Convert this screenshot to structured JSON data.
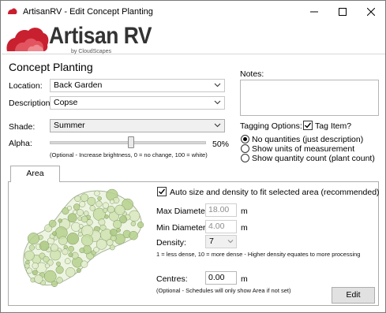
{
  "window": {
    "title": "ArtisanRV - Edit Concept Planting",
    "controls": {
      "minimize": "minimize-icon",
      "maximize": "maximize-icon",
      "close": "close-icon"
    }
  },
  "branding": {
    "product": "Artisan RV",
    "tagline": "by CloudScapes",
    "brand_color": "#c8202f"
  },
  "form": {
    "heading": "Concept Planting",
    "location": {
      "label": "Location:",
      "value": "Back Garden"
    },
    "description": {
      "label": "Description:",
      "value": "Copse"
    },
    "shade": {
      "label": "Shade:",
      "value": "Summer"
    },
    "alpha": {
      "label": "Alpha:",
      "value_text": "50%",
      "value": 50,
      "hint": "(Optional - Increase brightness, 0 = no change, 100 = white)"
    }
  },
  "notes": {
    "label": "Notes:",
    "value": ""
  },
  "tagging": {
    "label": "Tagging Options:",
    "tag_item": {
      "label": "Tag Item?",
      "checked": true
    },
    "options": [
      {
        "label": "No quantities (just description)",
        "selected": true
      },
      {
        "label": "Show units of measurement",
        "selected": false
      },
      {
        "label": "Show quantity count (plant count)",
        "selected": false
      }
    ]
  },
  "area_tab": {
    "tab_label": "Area",
    "auto_size": {
      "label": "Auto size and density to fit selected area (recommended)",
      "checked": true
    },
    "max_diameter": {
      "label": "Max Diameter:",
      "value": "18.00",
      "unit": "m"
    },
    "min_diameter": {
      "label": "Min Diameter:",
      "value": "4.00",
      "unit": "m"
    },
    "density": {
      "label": "Density:",
      "value": "7",
      "hint": "1 = less dense, 10 = more dense - Higher density equates to more processing"
    },
    "centres": {
      "label": "Centres:",
      "value": "0.00",
      "unit": "m",
      "hint": "(Optional - Schedules will only show Area if not set)"
    },
    "edit_button": "Edit"
  },
  "icons": {
    "app": "artisan-logo-icon",
    "chevron": "chevron-down-icon",
    "check": "checkmark-icon"
  }
}
